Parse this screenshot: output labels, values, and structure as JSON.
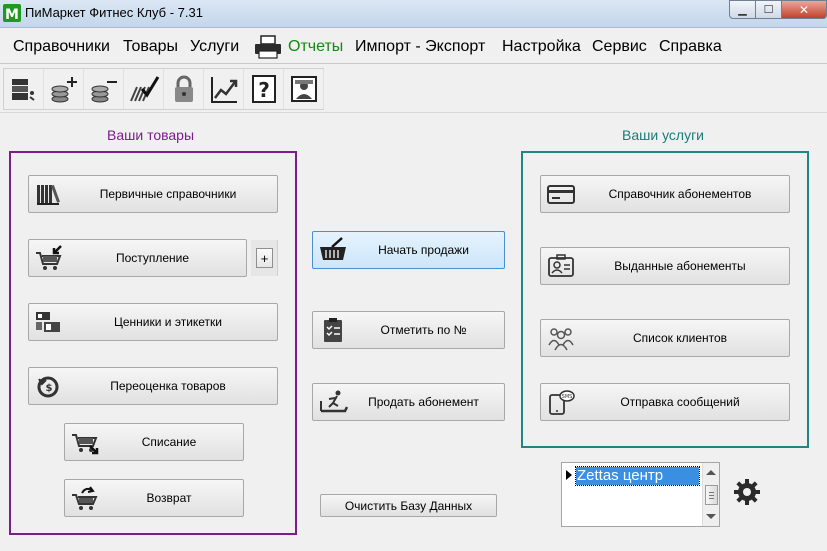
{
  "window": {
    "title": "ПиМаркет Фитнес Клуб - 7.31",
    "minimize_glyph": "▁",
    "maximize_glyph": "☐",
    "close_glyph": "✕"
  },
  "menu": {
    "items": [
      "Справочники",
      "Товары",
      "Услуги",
      "Отчеты",
      "Импорт - Экспорт",
      "Настройка",
      "Сервис",
      "Справка"
    ],
    "accent_color": "#128a12"
  },
  "toolbar": {
    "help_glyph": "?"
  },
  "goods": {
    "title": "Ваши товары",
    "color": "#7b1d8a",
    "buttons": {
      "dictionaries": "Первичные справочники",
      "receipt": "Поступление",
      "receipt_plus": "+",
      "labels": "Ценники и этикетки",
      "revaluation": "Переоценка товаров",
      "writeoff": "Списание",
      "return": "Возврат"
    }
  },
  "center": {
    "start_sales": "Начать продажи",
    "mark_by_number": "Отметить по №",
    "sell_subscription": "Продать абонемент",
    "clear_db": "Очистить Базу Данных"
  },
  "services": {
    "title": "Ваши услуги",
    "color": "#1f8683",
    "buttons": {
      "subscriptions_dir": "Справочник абонементов",
      "issued_subscriptions": "Выданные абонементы",
      "clients_list": "Список клиентов",
      "send_messages": "Отправка сообщений"
    }
  },
  "club_list": {
    "selected": "Zettas центр"
  }
}
